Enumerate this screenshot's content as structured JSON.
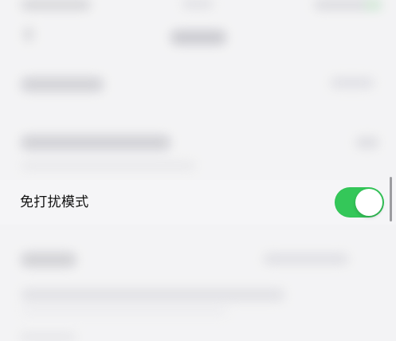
{
  "settings": {
    "focused_row": {
      "label": "免打扰模式",
      "toggle_state": "on",
      "toggle_color": "#34c759"
    }
  },
  "colors": {
    "background": "#f3f3f5",
    "toggle_on": "#34c759",
    "toggle_thumb": "#ffffff"
  },
  "icons": {
    "toggle": "switch",
    "back": "back-arrow-icon"
  }
}
